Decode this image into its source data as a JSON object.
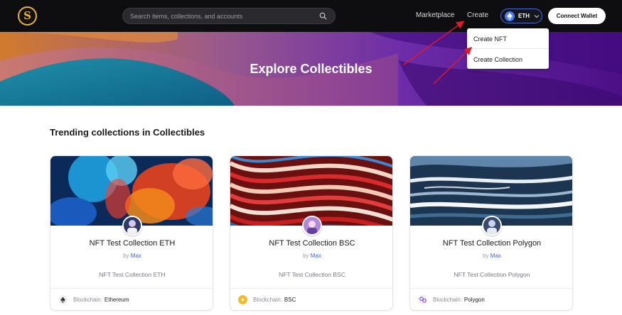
{
  "header": {
    "logo_letter": "S",
    "search_placeholder": "Search items, collections, and accounts",
    "nav": {
      "marketplace": "Marketplace",
      "create": "Create"
    },
    "chain_selector": {
      "label": "ETH",
      "icon": "ethereum-icon"
    },
    "connect_wallet": "Connect Wallet"
  },
  "create_menu": {
    "items": [
      "Create NFT",
      "Create Collection"
    ]
  },
  "banner": {
    "title": "Explore Collectibles"
  },
  "section": {
    "title": "Trending collections in Collectibles"
  },
  "cards": [
    {
      "title": "NFT Test Collection ETH",
      "by_prefix": "by",
      "author": "Max",
      "description": "NFT Test Collection ETH",
      "chain_key": "Blockchain:",
      "chain_value": "Ethereum",
      "chain_icon": "ethereum-icon"
    },
    {
      "title": "NFT Test Collection BSC",
      "by_prefix": "by",
      "author": "Max",
      "description": "NFT Test Collection BSC",
      "chain_key": "Blockchain:",
      "chain_value": "BSC",
      "chain_icon": "bsc-icon"
    },
    {
      "title": "NFT Test Collection Polygon",
      "by_prefix": "by",
      "author": "Max",
      "description": "NFT Test Collection Polygon",
      "chain_key": "Blockchain:",
      "chain_value": "Polygon",
      "chain_icon": "polygon-icon"
    }
  ],
  "colors": {
    "header_bg": "#0e0e10",
    "accent_blue": "#3d62d9",
    "annotation_red": "#e01b24",
    "logo_gold": "#e8b437"
  }
}
